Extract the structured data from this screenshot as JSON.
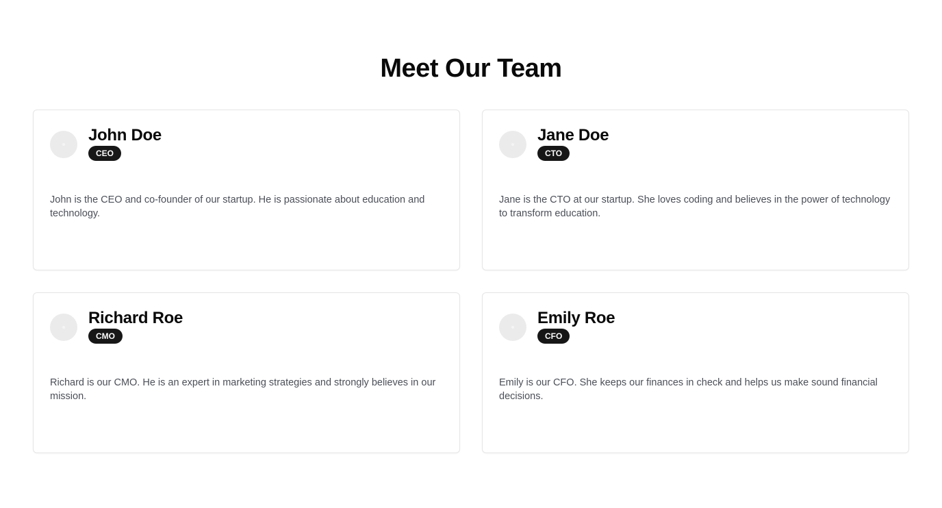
{
  "page": {
    "title": "Meet Our Team"
  },
  "team": [
    {
      "name": "John Doe",
      "role": "CEO",
      "bio": "John is the CEO and co-founder of our startup. He is passionate about education and technology."
    },
    {
      "name": "Jane Doe",
      "role": "CTO",
      "bio": "Jane is the CTO at our startup. She loves coding and believes in the power of technology to transform education."
    },
    {
      "name": "Richard Roe",
      "role": "CMO",
      "bio": "Richard is our CMO. He is an expert in marketing strategies and strongly believes in our mission."
    },
    {
      "name": "Emily Roe",
      "role": "CFO",
      "bio": "Emily is our CFO. She keeps our finances in check and helps us make sound financial decisions."
    }
  ],
  "colors": {
    "badge_bg": "#171717",
    "badge_text": "#fafafa",
    "avatar_bg": "#ebebeb",
    "card_border": "#e5e5e5",
    "bio_text": "#4b4f58"
  }
}
